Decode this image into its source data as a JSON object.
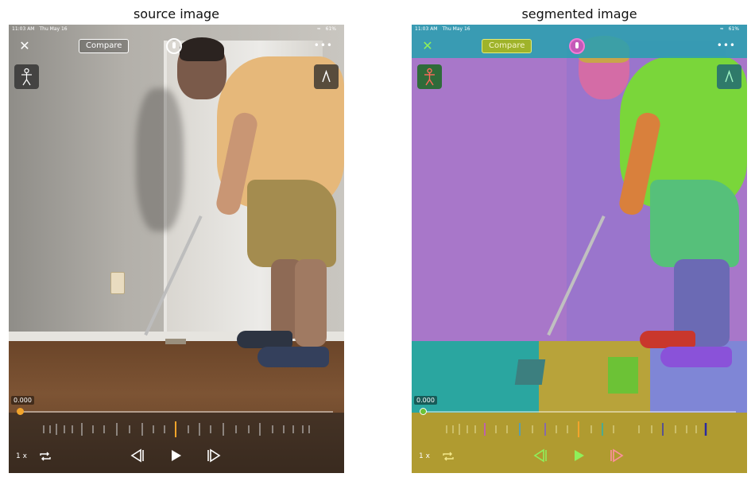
{
  "titles": {
    "left": "source image",
    "right": "segmented image"
  },
  "status_bar": {
    "time": "11:03 AM",
    "date": "Thu May 16",
    "battery": "61%"
  },
  "toolbar": {
    "compare_label": "Compare",
    "more_label": "•••",
    "close_label": "✕"
  },
  "player": {
    "timestamp": "0.000",
    "speed_label": "1 x",
    "progress": 0.0
  },
  "colors": {
    "accent": "#f2a42b",
    "knob_right": "#6cc236",
    "segmentation_top": "#2c9fb0"
  }
}
